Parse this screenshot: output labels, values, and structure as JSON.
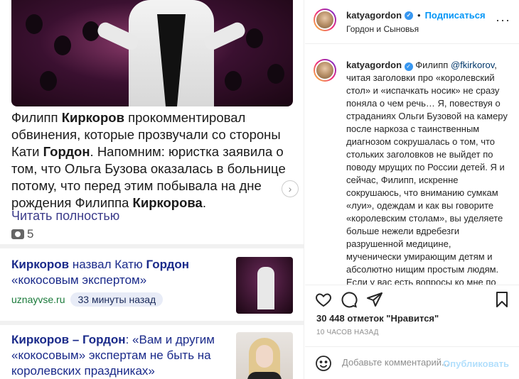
{
  "article": {
    "p1": "Филипп ",
    "p1b": "Киркоров",
    "p2": " прокомментировал обвинения, которые прозвучали со стороны Кати ",
    "p2b": "Гордон",
    "p3": ". Напомним: юристка заявила о том, что Ольга Бузова оказалась в больнице потому, что перед этим побывала на дне рождения Филиппа ",
    "p3b": "Киркорова",
    "p4": ".",
    "read_more": "Читать полностью",
    "photo_count": "5"
  },
  "cards": [
    {
      "title_b1": "Киркоров",
      "title_1": " назвал Катю ",
      "title_b2": "Гордон",
      "title_2": " «кокосовым экспертом»",
      "source": "uznayvse.ru",
      "time": "33 минуты назад"
    },
    {
      "title_b1": "Киркоров – Гордон",
      "title_1": ": «Вам и другим «кокосовым» экспертам не быть на королевских праздниках»"
    }
  ],
  "header": {
    "username": "katyagordon",
    "follow_sep": "•",
    "follow": "Подписаться",
    "location": "Гордон и Сыновья"
  },
  "caption": {
    "username": "katyagordon",
    "t1": " Филипп ",
    "mention": "@fkirkorov",
    "t2": ", читая заголовки про «королевский стол» и «испачкать носик» не сразу поняла о чем речь… Я, повествуя о страданиях Ольги Бузовой на камеру после наркоза с таинственным диагнозом сокрушалась о том, что стольких заголовков не выйдет по поводу мрущих по России детей. Я и сейчас, Филипп, искренне сокрушаюсь, что вниманию сумкам «луи», одеждам и как вы говорите «королевским столам», вы уделяете больше нежели вдребезги разрушенной медицине, мученически умирающим детям и абсолютно нищим простым людям. Если у вас есть вопросы ко мне по медицине (анализы и т.д.) …"
  },
  "likes": "30 448 отметок \"Нравится\"",
  "time": "10 ЧАСОВ НАЗАД",
  "comment": {
    "placeholder": "Добавьте комментарий...",
    "publish": "Опубликовать"
  },
  "colors": {
    "link": "#0095f6",
    "verified": "#3897f0",
    "news_title": "#1a2a8a",
    "news_source": "#1a7a3a"
  },
  "icons": [
    "heart-icon",
    "comment-icon",
    "share-icon",
    "bookmark-icon",
    "smile-icon",
    "camera-icon",
    "chevron-right-icon",
    "more-icon",
    "verified-icon"
  ]
}
